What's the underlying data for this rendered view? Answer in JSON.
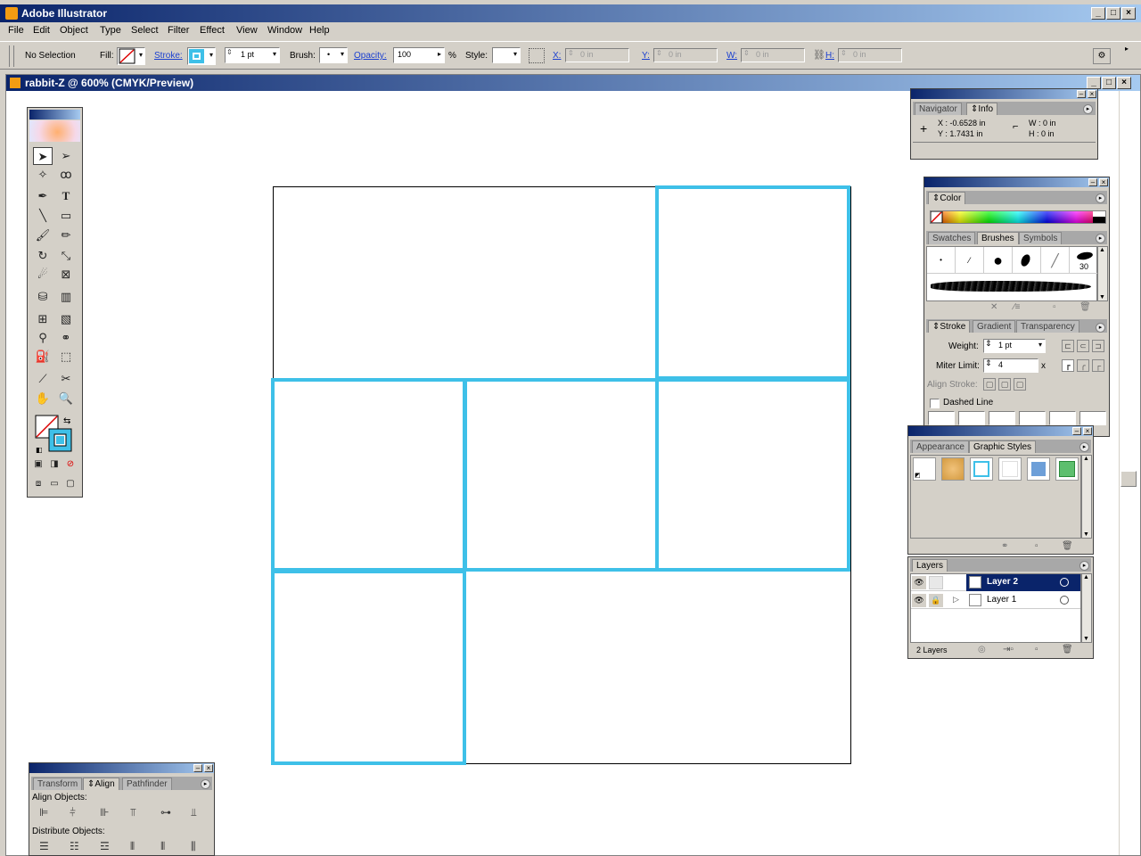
{
  "app": {
    "title": "Adobe Illustrator"
  },
  "menu": [
    "File",
    "Edit",
    "Object",
    "Type",
    "Select",
    "Filter",
    "Effect",
    "View",
    "Window",
    "Help"
  ],
  "control": {
    "selection": "No Selection",
    "fill_label": "Fill:",
    "stroke_label": "Stroke:",
    "stroke_weight": "1 pt",
    "brush_label": "Brush:",
    "opacity_label": "Opacity:",
    "opacity_value": "100",
    "percent": "%",
    "style_label": "Style:",
    "x_label": "X:",
    "x_value": "0 in",
    "y_label": "Y:",
    "y_value": "0 in",
    "w_label": "W:",
    "w_value": "0 in",
    "h_label": "H:",
    "h_value": "0 in"
  },
  "document": {
    "title": "rabbit-Z @ 600% (CMYK/Preview)"
  },
  "artwork": {
    "stroke_color": "#3ec0e8",
    "frame_color": "#000000",
    "cell_count": 6
  },
  "info": {
    "tab_navigator": "Navigator",
    "tab_info": "Info",
    "x": "X : -0.6528 in",
    "y": "Y : 1.7431 in",
    "w": "W : 0 in",
    "h": "H : 0 in"
  },
  "color_panel": {
    "tab": "Color"
  },
  "brushes_panel": {
    "tabs": [
      "Swatches",
      "Brushes",
      "Symbols"
    ],
    "size_label": "30"
  },
  "stroke_panel": {
    "tabs": [
      "Stroke",
      "Gradient",
      "Transparency"
    ],
    "weight_label": "Weight:",
    "weight_value": "1 pt",
    "miter_label": "Miter Limit:",
    "miter_value": "4",
    "miter_unit": "x",
    "align_label": "Align Stroke:",
    "dashed_label": "Dashed Line"
  },
  "gstyles_panel": {
    "tabs": [
      "Appearance",
      "Graphic Styles"
    ]
  },
  "layers_panel": {
    "tab": "Layers",
    "layers": [
      {
        "name": "Layer 2",
        "selected": true
      },
      {
        "name": "Layer 1",
        "selected": false
      }
    ],
    "footer": "2 Layers"
  },
  "align_panel": {
    "tabs": [
      "Transform",
      "Align",
      "Pathfinder"
    ],
    "align_label": "Align Objects:",
    "distribute_label": "Distribute Objects:"
  },
  "colors": {
    "selection_blue": "#0a246a",
    "accent": "#3ec0e8"
  }
}
